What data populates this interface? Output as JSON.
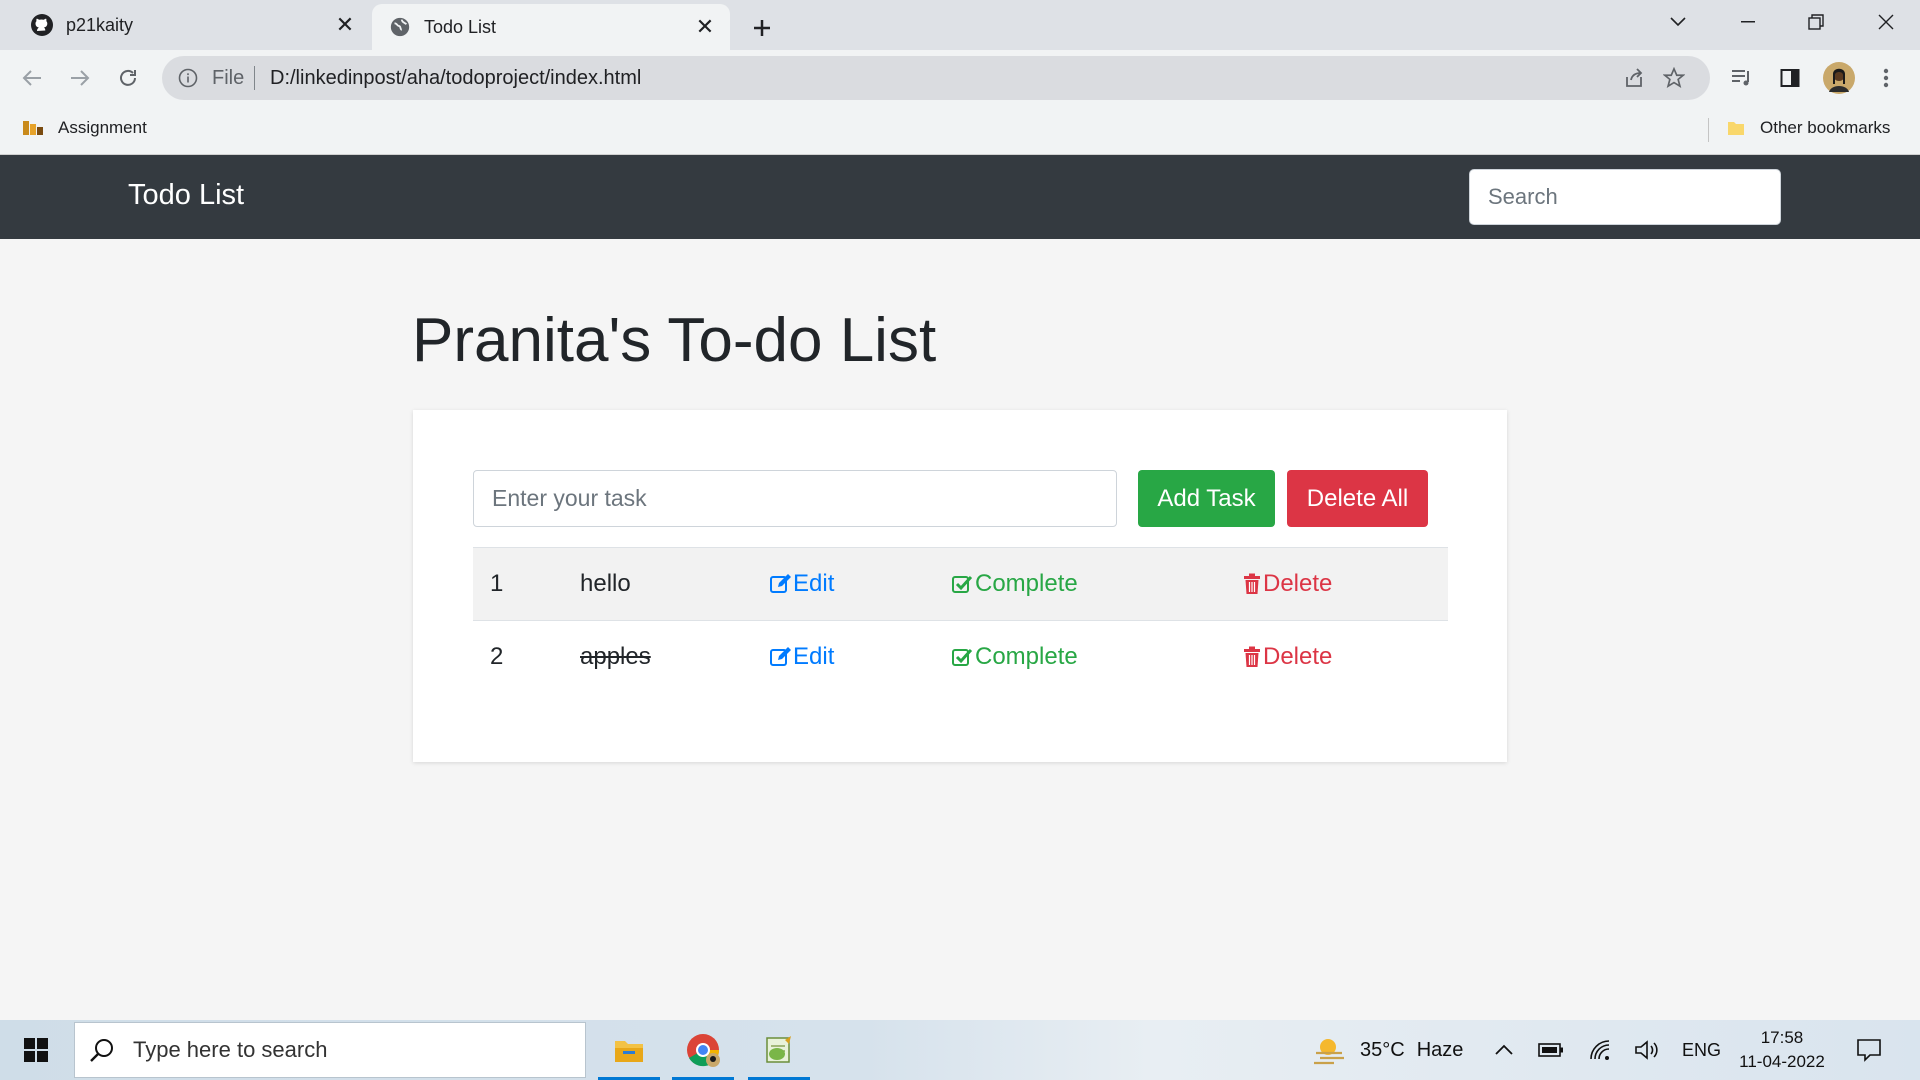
{
  "browser": {
    "tabs": [
      {
        "title": "p21kaity",
        "icon": "github-icon"
      },
      {
        "title": "Todo List",
        "icon": "globe-icon"
      }
    ],
    "address": {
      "scheme": "File",
      "url": "D:/linkedinpost/aha/todoproject/index.html"
    },
    "bookmarks": {
      "left": "Assignment",
      "right": "Other bookmarks"
    }
  },
  "page": {
    "navbar": {
      "brand": "Todo List",
      "search_placeholder": "Search"
    },
    "heading": "Pranita's To-do List",
    "form": {
      "placeholder": "Enter your task",
      "add_label": "Add Task",
      "delete_all_label": "Delete All"
    },
    "tasks": [
      {
        "num": "1",
        "text": "hello",
        "done": false,
        "edit": "Edit",
        "complete": "Complete",
        "delete": "Delete"
      },
      {
        "num": "2",
        "text": "apples",
        "done": true,
        "edit": "Edit",
        "complete": "Complete",
        "delete": "Delete"
      }
    ],
    "colors": {
      "navbar": "#343a40",
      "success": "#28a745",
      "danger": "#dc3545",
      "primary": "#007bff"
    }
  },
  "taskbar": {
    "search_placeholder": "Type here to search",
    "weather": {
      "temp": "35°C",
      "condition": "Haze"
    },
    "language": "ENG",
    "time": "17:58",
    "date": "11-04-2022"
  }
}
